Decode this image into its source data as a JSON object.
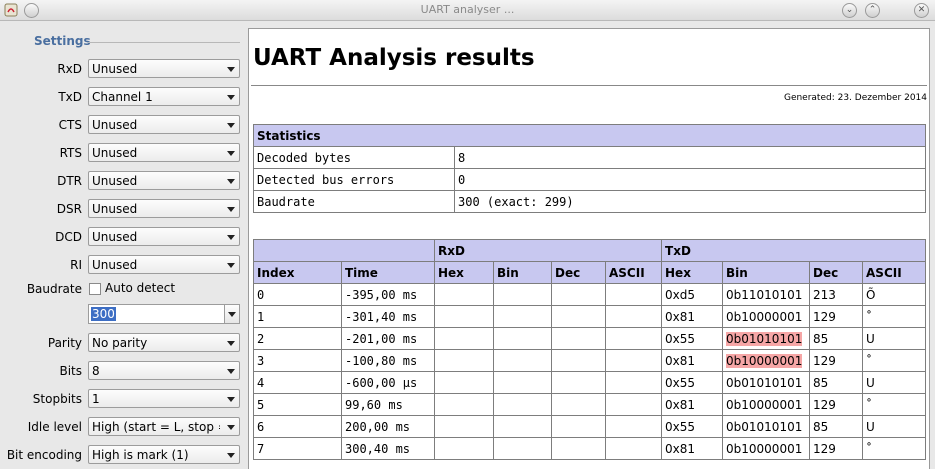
{
  "window": {
    "title": "UART analyser ...",
    "controls": [
      "minimize",
      "maximize",
      "close"
    ]
  },
  "settings": {
    "header": "Settings",
    "rows": [
      {
        "label": "RxD",
        "value": "Unused"
      },
      {
        "label": "TxD",
        "value": "Channel 1"
      },
      {
        "label": "CTS",
        "value": "Unused"
      },
      {
        "label": "RTS",
        "value": "Unused"
      },
      {
        "label": "DTR",
        "value": "Unused"
      },
      {
        "label": "DSR",
        "value": "Unused"
      },
      {
        "label": "DCD",
        "value": "Unused"
      },
      {
        "label": "RI",
        "value": "Unused"
      }
    ],
    "baudrate_label": "Baudrate",
    "auto_detect_label": "Auto detect",
    "auto_detect_checked": false,
    "baudrate_value": "300",
    "parity_label": "Parity",
    "parity_value": "No parity",
    "bits_label": "Bits",
    "bits_value": "8",
    "stopbits_label": "Stopbits",
    "stopbits_value": "1",
    "idle_label": "Idle level",
    "idle_value": "High (start = L, stop = H)",
    "encoding_label": "Bit encoding",
    "encoding_value": "High is mark (1)"
  },
  "results": {
    "title": "UART Analysis results",
    "generated": "Generated: 23. Dezember 2014",
    "stats_header": "Statistics",
    "stats": [
      {
        "label": "Decoded bytes",
        "value": "8"
      },
      {
        "label": "Detected bus errors",
        "value": "0"
      },
      {
        "label": "Baudrate",
        "value": "300 (exact: 299)"
      }
    ],
    "group_rxd": "RxD",
    "group_txd": "TxD",
    "columns": [
      "Index",
      "Time",
      "Hex",
      "Bin",
      "Dec",
      "ASCII",
      "Hex",
      "Bin",
      "Dec",
      "ASCII"
    ],
    "rows": [
      {
        "index": "0",
        "time": "-395,00 ms",
        "hex": "0xd5",
        "bin": "0b11010101",
        "dec": "213",
        "ascii": "Õ",
        "error": false
      },
      {
        "index": "1",
        "time": "-301,40 ms",
        "hex": "0x81",
        "bin": "0b10000001",
        "dec": "129",
        "ascii": "˚",
        "error": false
      },
      {
        "index": "2",
        "time": "-201,00 ms",
        "hex": "0x55",
        "bin": "0b01010101",
        "dec": "85",
        "ascii": "U",
        "error": true
      },
      {
        "index": "3",
        "time": "-100,80 ms",
        "hex": "0x81",
        "bin": "0b10000001",
        "dec": "129",
        "ascii": "˚",
        "error": true
      },
      {
        "index": "4",
        "time": "-600,00 µs",
        "hex": "0x55",
        "bin": "0b01010101",
        "dec": "85",
        "ascii": "U",
        "error": false
      },
      {
        "index": "5",
        "time": "99,60 ms",
        "hex": "0x81",
        "bin": "0b10000001",
        "dec": "129",
        "ascii": "˚",
        "error": false
      },
      {
        "index": "6",
        "time": "200,00 ms",
        "hex": "0x55",
        "bin": "0b01010101",
        "dec": "85",
        "ascii": "U",
        "error": false
      },
      {
        "index": "7",
        "time": "300,40 ms",
        "hex": "0x81",
        "bin": "0b10000001",
        "dec": "129",
        "ascii": "˚",
        "error": false
      }
    ]
  },
  "colors": {
    "header_bg": "#c8c8f0",
    "error_highlight": "#f6a6a6",
    "settings_header": "#4a6fa0"
  }
}
